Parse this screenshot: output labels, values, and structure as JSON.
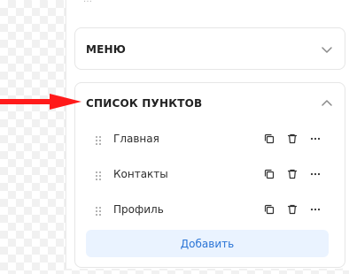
{
  "header": {
    "fragment_text": "..."
  },
  "sections": {
    "menu": {
      "title": "МЕНЮ",
      "icon": "chevron-down-icon"
    },
    "list": {
      "title": "СПИСОК ПУНКТОВ",
      "icon": "chevron-up-icon",
      "items": [
        {
          "label": "Главная"
        },
        {
          "label": "Контакты"
        },
        {
          "label": "Профиль"
        }
      ],
      "add_label": "Добавить"
    }
  },
  "colors": {
    "accent": "#2a74d6",
    "add_bg": "#eaf3ff",
    "annotation_red": "#ff1a1a"
  },
  "icons": {
    "drag": "drag-handle-icon",
    "copy": "copy-icon",
    "delete": "trash-icon",
    "more": "more-icon"
  }
}
